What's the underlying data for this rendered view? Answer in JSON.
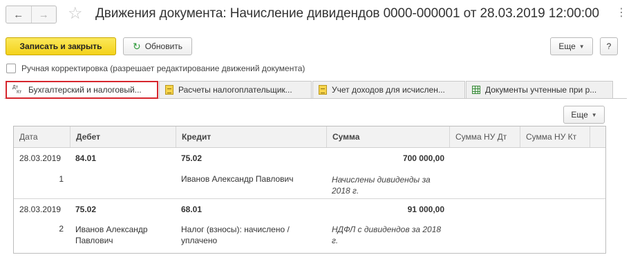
{
  "header": {
    "back_icon": "arrow-left-icon",
    "forward_icon": "arrow-right-icon",
    "favorite_icon": "star-icon",
    "title": "Движения документа: Начисление дивидендов 0000-000001 от 28.03.2019 12:00:00",
    "more_icon": "vertical-dots-icon"
  },
  "toolbar": {
    "save_close_label": "Записать и закрыть",
    "refresh_label": "Обновить",
    "more_label": "Еще",
    "help_label": "?"
  },
  "manual_correction": {
    "label": "Ручная корректировка (разрешает редактирование движений документа)",
    "checked": false
  },
  "tabs": [
    {
      "label": "Бухгалтерский и налоговый...",
      "icon": "dt-kt-icon",
      "active": true
    },
    {
      "label": "Расчеты налогоплательщик...",
      "icon": "register-icon",
      "active": false
    },
    {
      "label": "Учет доходов для исчислен...",
      "icon": "register-icon",
      "active": false
    },
    {
      "label": "Документы учтенные при р...",
      "icon": "table-icon",
      "active": false
    }
  ],
  "table_toolbar": {
    "more_label": "Еще"
  },
  "table": {
    "columns": [
      "Дата",
      "Дебет",
      "Кредит",
      "Сумма",
      "Сумма НУ Дт",
      "Сумма НУ Кт"
    ],
    "rows": [
      {
        "date": "28.03.2019",
        "number": "1",
        "debit": "84.01",
        "debit_sub": "",
        "credit": "75.02",
        "credit_sub": "Иванов Александр Павлович",
        "amount": "700 000,00",
        "content": "Начислены дивиденды за 2018 г."
      },
      {
        "date": "28.03.2019",
        "number": "2",
        "debit": "75.02",
        "debit_sub": "Иванов Александр Павлович",
        "credit": "68.01",
        "credit_sub": "Налог (взносы): начислено / уплачено",
        "amount": "91 000,00",
        "content": "НДФЛ с дивидендов за 2018 г."
      }
    ]
  }
}
